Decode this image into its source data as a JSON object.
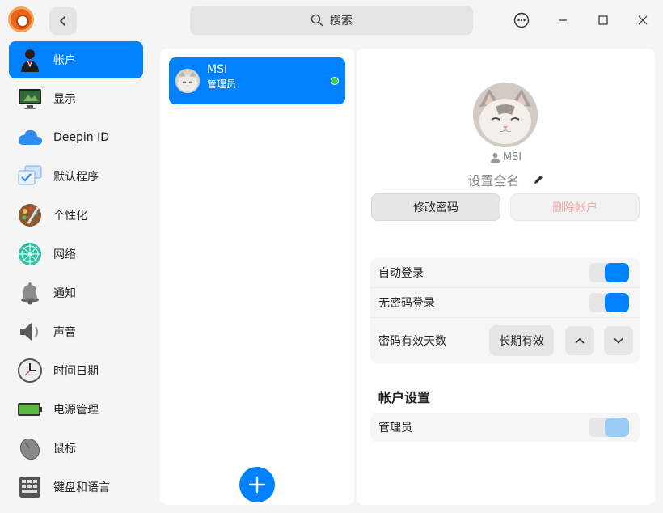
{
  "titlebar": {
    "search_label": "搜索",
    "icons": [
      "app-logo-icon",
      "chevron-left-icon",
      "search-icon",
      "more-icon",
      "minimize-icon",
      "maximize-icon",
      "close-icon"
    ]
  },
  "sidebar": {
    "items": [
      {
        "label": "帐户",
        "icon": "account-icon",
        "active": true
      },
      {
        "label": "显示",
        "icon": "display-icon"
      },
      {
        "label": "Deepin ID",
        "icon": "cloud-icon"
      },
      {
        "label": "默认程序",
        "icon": "default-apps-icon"
      },
      {
        "label": "个性化",
        "icon": "palette-icon"
      },
      {
        "label": "网络",
        "icon": "network-icon"
      },
      {
        "label": "通知",
        "icon": "bell-icon"
      },
      {
        "label": "声音",
        "icon": "speaker-icon"
      },
      {
        "label": "时间日期",
        "icon": "clock-icon"
      },
      {
        "label": "电源管理",
        "icon": "battery-icon"
      },
      {
        "label": "鼠标",
        "icon": "mouse-icon"
      },
      {
        "label": "键盘和语言",
        "icon": "keyboard-icon"
      }
    ]
  },
  "users": {
    "list": [
      {
        "name": "MSI",
        "role": "管理员",
        "online": true
      }
    ]
  },
  "detail": {
    "username": "MSI",
    "fullname_placeholder": "设置全名",
    "change_password": "修改密码",
    "delete_account": "删除帐户",
    "auto_login": {
      "label": "自动登录",
      "on": true
    },
    "passwordless_login": {
      "label": "无密码登录",
      "on": true
    },
    "password_validity": {
      "label": "密码有效天数",
      "value": "长期有效"
    },
    "account_settings_title": "帐户设置",
    "administrator": {
      "label": "管理员",
      "on": true
    }
  },
  "colors": {
    "accent": "#0081ff",
    "online": "#37d34a",
    "danger_disabled": "#f2a8a8"
  }
}
